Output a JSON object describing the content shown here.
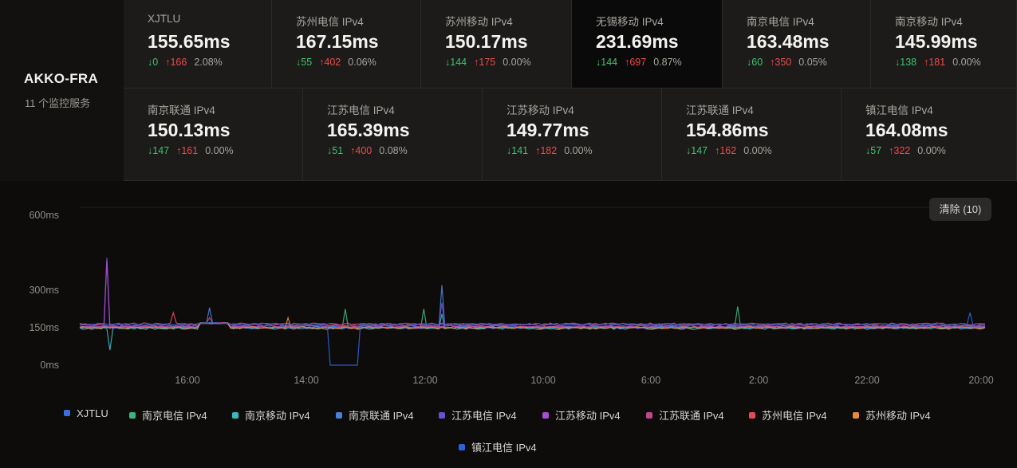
{
  "server": {
    "name": "AKKO-FRA",
    "subtitle": "11 个监控服务"
  },
  "cards": [
    {
      "name": "XJTLU",
      "latency": "155.65ms",
      "down": "↓0",
      "up": "↑166",
      "loss": "2.08%"
    },
    {
      "name": "苏州电信 IPv4",
      "latency": "167.15ms",
      "down": "↓55",
      "up": "↑402",
      "loss": "0.06%"
    },
    {
      "name": "苏州移动 IPv4",
      "latency": "150.17ms",
      "down": "↓144",
      "up": "↑175",
      "loss": "0.00%"
    },
    {
      "name": "无锡移动 IPv4",
      "latency": "231.69ms",
      "down": "↓144",
      "up": "↑697",
      "loss": "0.87%"
    },
    {
      "name": "南京电信 IPv4",
      "latency": "163.48ms",
      "down": "↓60",
      "up": "↑350",
      "loss": "0.05%"
    },
    {
      "name": "南京移动 IPv4",
      "latency": "145.99ms",
      "down": "↓138",
      "up": "↑181",
      "loss": "0.00%"
    },
    {
      "name": "南京联通 IPv4",
      "latency": "150.13ms",
      "down": "↓147",
      "up": "↑161",
      "loss": "0.00%"
    },
    {
      "name": "江苏电信 IPv4",
      "latency": "165.39ms",
      "down": "↓51",
      "up": "↑400",
      "loss": "0.08%"
    },
    {
      "name": "江苏移动 IPv4",
      "latency": "149.77ms",
      "down": "↓141",
      "up": "↑182",
      "loss": "0.00%"
    },
    {
      "name": "江苏联通 IPv4",
      "latency": "154.86ms",
      "down": "↓147",
      "up": "↑162",
      "loss": "0.00%"
    },
    {
      "name": "镇江电信 IPv4",
      "latency": "164.08ms",
      "down": "↓57",
      "up": "↑322",
      "loss": "0.00%"
    }
  ],
  "clear_button": "清除 (10)",
  "colors": {
    "down": "#3ec46d",
    "up": "#ef4a4a",
    "background": "#0d0c0b",
    "card": "#1c1b1a"
  },
  "chart_data": {
    "type": "line",
    "y_ticks": [
      "600ms",
      "300ms",
      "150ms",
      "0ms"
    ],
    "y_tick_values": [
      600,
      300,
      150,
      0
    ],
    "ylim": [
      0,
      600
    ],
    "x_ticks": [
      "16:00",
      "14:00",
      "12:00",
      "10:00",
      "6:00",
      "2:00",
      "22:00",
      "20:00"
    ],
    "x_tick_hours": [
      -28,
      -30,
      -32,
      -34,
      -38,
      -42,
      -46,
      -48
    ],
    "xlim": [
      -30.7,
      -48.0
    ],
    "grid": false,
    "legend": "bottom",
    "series": [
      {
        "name": "XJTLU",
        "color": "#3b6fe0",
        "base": 153,
        "spikes": []
      },
      {
        "name": "南京电信 IPv4",
        "color": "#3fb27f",
        "base": 150,
        "spikes": [
          [
            -35.8,
            225
          ],
          [
            -37.3,
            225
          ],
          [
            -43.3,
            235
          ]
        ]
      },
      {
        "name": "南京移动 IPv4",
        "color": "#3ab8c0",
        "base": 147,
        "spikes": [
          [
            -31.3,
            375
          ],
          [
            -31.3,
            60
          ],
          [
            -37.6,
            205
          ]
        ]
      },
      {
        "name": "南京联通 IPv4",
        "color": "#4a7fd6",
        "base": 152,
        "spikes": [
          [
            -33.2,
            230
          ],
          [
            -37.6,
            320
          ]
        ]
      },
      {
        "name": "江苏电信 IPv4",
        "color": "#6a4fd6",
        "base": 160,
        "spikes": [
          [
            -31.2,
            430
          ],
          [
            -37.6,
            250
          ]
        ]
      },
      {
        "name": "江苏移动 IPv4",
        "color": "#a64fd0",
        "base": 151,
        "spikes": [
          [
            -31.2,
            420
          ]
        ]
      },
      {
        "name": "江苏联通 IPv4",
        "color": "#c0458a",
        "base": 156,
        "spikes": [
          [
            -33.2,
            190
          ]
        ]
      },
      {
        "name": "苏州电信 IPv4",
        "color": "#e04a5f",
        "base": 165,
        "spikes": [
          [
            -32.5,
            210
          ]
        ]
      },
      {
        "name": "苏州移动 IPv4",
        "color": "#e88a3a",
        "base": 150,
        "spikes": [
          [
            -34.7,
            190
          ]
        ]
      },
      {
        "name": "镇江电信 IPv4",
        "color": "#2f62d8",
        "base": 164,
        "spikes": [
          [
            -35.5,
            0
          ],
          [
            -36.0,
            0
          ],
          [
            -47.7,
            210
          ]
        ]
      }
    ]
  }
}
